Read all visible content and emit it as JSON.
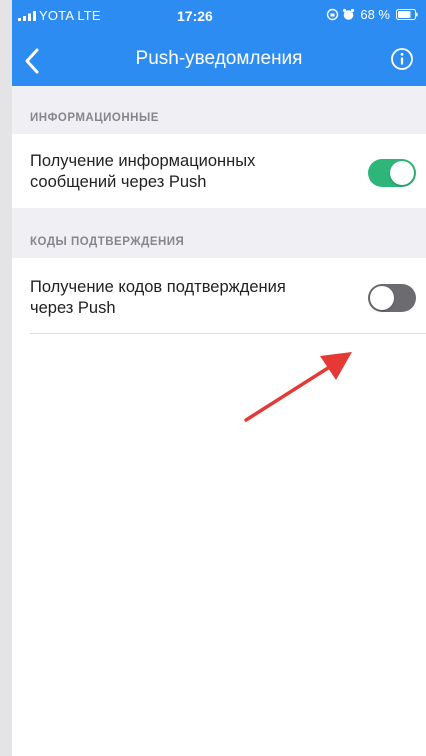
{
  "status_bar": {
    "carrier": "YOTA  LTE",
    "time": "17:26",
    "battery_percent": "68 %"
  },
  "nav": {
    "title": "Push-уведомления",
    "back_icon": "chevron-left-icon",
    "info_icon": "info-icon"
  },
  "sections": [
    {
      "header": "ИНФОРМАЦИОННЫЕ",
      "rows": [
        {
          "label_line1": "Получение информационных",
          "label_line2": "сообщений через Push",
          "toggle_on": true
        }
      ]
    },
    {
      "header": "КОДЫ ПОДТВЕРЖДЕНИЯ",
      "rows": [
        {
          "label_line1": "Получение кодов подтверждения",
          "label_line2": "через Push",
          "toggle_on": false
        }
      ]
    }
  ],
  "colors": {
    "header_bg": "#2c8cf2",
    "toggle_on": "#2eb67a",
    "toggle_off": "#6c6c70",
    "annotation_arrow": "#e53935"
  }
}
